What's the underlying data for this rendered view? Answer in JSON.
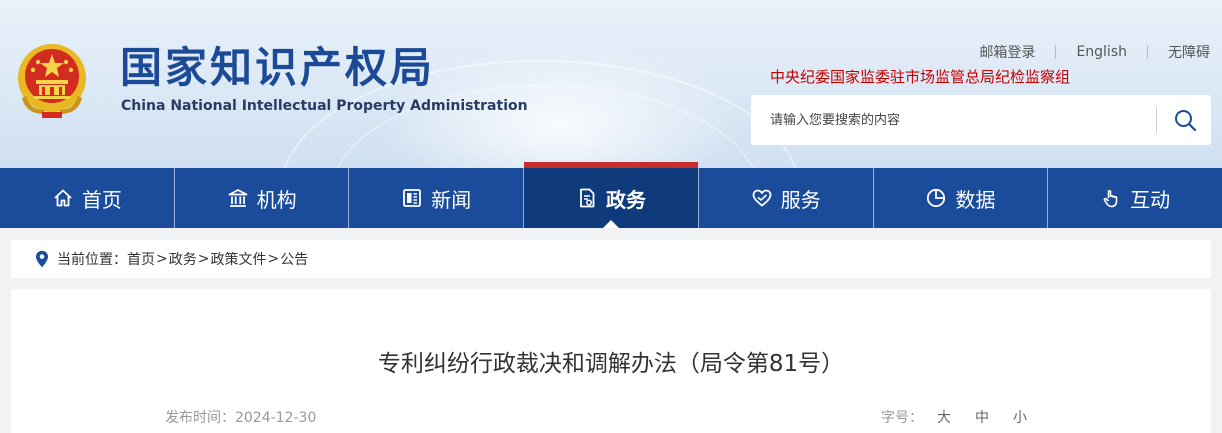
{
  "header": {
    "title_cn": "国家知识产权局",
    "title_en": "China National Intellectual Property Administration",
    "top_links": [
      "邮箱登录",
      "English",
      "无障碍"
    ],
    "discipline_notice": "中央纪委国家监委驻市场监管总局纪检监察组",
    "search_placeholder": "请输入您要搜索的内容"
  },
  "nav": {
    "items": [
      {
        "label": "首页",
        "icon": "home-icon"
      },
      {
        "label": "机构",
        "icon": "building-icon"
      },
      {
        "label": "新闻",
        "icon": "newspaper-icon"
      },
      {
        "label": "政务",
        "icon": "document-icon",
        "active": true
      },
      {
        "label": "服务",
        "icon": "heart-hands-icon"
      },
      {
        "label": "数据",
        "icon": "pie-chart-icon"
      },
      {
        "label": "互动",
        "icon": "hand-pointer-icon"
      }
    ]
  },
  "breadcrumb": {
    "prefix": "当前位置：",
    "items": [
      "首页",
      "政务",
      "政策文件",
      "公告"
    ],
    "separator": ">"
  },
  "article": {
    "title": "专利纠纷行政裁决和调解办法（局令第81号）",
    "date_label": "发布时间：2024-12-30",
    "font_size_label": "字号：",
    "font_size_options": [
      "大",
      "中",
      "小"
    ]
  },
  "colors": {
    "nav_bg": "#1b4c9b",
    "nav_active_bg": "#0f3b7c",
    "nav_active_accent": "#c52f2f",
    "title_blue": "#1d4a96",
    "notice_red": "#c40000"
  }
}
